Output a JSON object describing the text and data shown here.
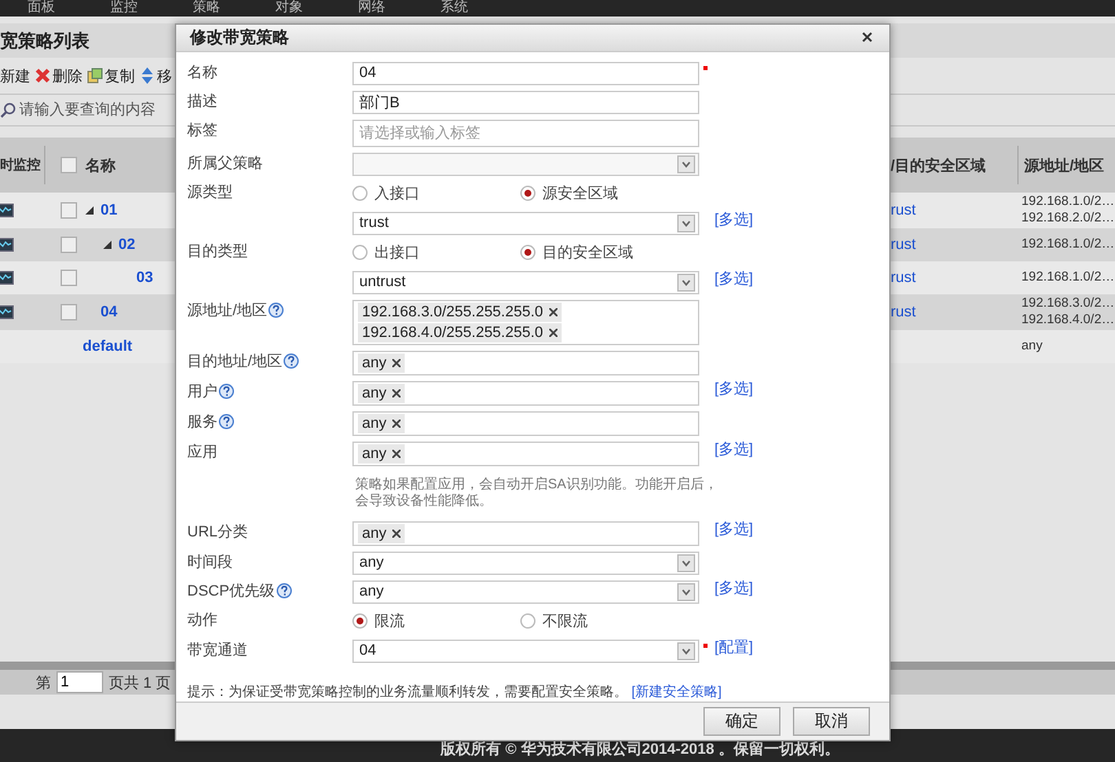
{
  "top_nav": [
    "面板",
    "监控",
    "策略",
    "对象",
    "网络",
    "系统"
  ],
  "policy_list": {
    "title": "宽策略列表",
    "toolbar": [
      {
        "kind": "new",
        "label": "新建"
      },
      {
        "kind": "delete",
        "label": "删除"
      },
      {
        "kind": "copy",
        "label": "复制"
      },
      {
        "kind": "move",
        "label": "移"
      }
    ],
    "search": {
      "placeholder": "请输入要查询的内容"
    },
    "columns": [
      "时监控",
      "名称",
      "/目的安全区域",
      "源地址/地区"
    ],
    "select_all": {
      "checked": false
    },
    "rows": [
      {
        "kind": "policy",
        "name": "01",
        "checked": false,
        "expanded": true,
        "zone": "rust",
        "sources": [
          "192.168.1.0/2…",
          "192.168.2.0/2…"
        ],
        "children": [
          {
            "kind": "policy",
            "name": "02",
            "checked": false,
            "expanded": true,
            "zone": "rust",
            "sources": [
              "192.168.1.0/2…"
            ],
            "children": [
              {
                "kind": "policy",
                "name": "03",
                "checked": false,
                "zone": "rust",
                "sources": [
                  "192.168.1.0/2…"
                ]
              }
            ]
          }
        ]
      },
      {
        "kind": "policy",
        "name": "04",
        "checked": false,
        "zone": "rust",
        "sources": [
          "192.168.3.0/2…",
          "192.168.4.0/2…"
        ]
      },
      {
        "kind": "default",
        "name": "default",
        "sources": [
          "any"
        ]
      }
    ],
    "pagination": {
      "prefix": "第",
      "page": "1",
      "suffix": "页共 1 页"
    }
  },
  "dialog": {
    "title": "修改带宽策略",
    "fields": [
      {
        "kind": "text",
        "label": "名称",
        "value": "04",
        "required": true
      },
      {
        "kind": "text",
        "label": "描述",
        "value": "部门B"
      },
      {
        "kind": "text",
        "label": "标签",
        "placeholder": "请选择或输入标签"
      },
      {
        "kind": "select",
        "label": "所属父策略",
        "disabled": true
      },
      {
        "kind": "radio",
        "label": "源类型",
        "options": [
          {
            "label": "入接口",
            "selected": false
          },
          {
            "label": "源安全区域",
            "selected": true
          }
        ]
      },
      {
        "kind": "select",
        "value": "trust",
        "link": "[多选]"
      },
      {
        "kind": "radio",
        "label": "目的类型",
        "options": [
          {
            "label": "出接口",
            "selected": false
          },
          {
            "label": "目的安全区域",
            "selected": true
          }
        ]
      },
      {
        "kind": "select",
        "value": "untrust",
        "link": "[多选]"
      },
      {
        "kind": "tags",
        "label": "源地址/地区",
        "help": true,
        "tags": [
          "192.168.3.0/255.255.255.0",
          "192.168.4.0/255.255.255.0"
        ]
      },
      {
        "kind": "tags",
        "label": "目的地址/地区",
        "help": true,
        "tags": [
          "any"
        ]
      },
      {
        "kind": "tags",
        "label": "用户",
        "help": true,
        "tags": [
          "any"
        ],
        "link": "[多选]"
      },
      {
        "kind": "tags",
        "label": "服务",
        "help": true,
        "tags": [
          "any"
        ]
      },
      {
        "kind": "tags",
        "label": "应用",
        "tags": [
          "any"
        ],
        "link": "[多选]"
      },
      {
        "kind": "note",
        "text": "策略如果配置应用，会自动开启SA识别功能。功能开启后，会导致设备性能降低。"
      },
      {
        "kind": "tags",
        "label": "URL分类",
        "tags": [
          "any"
        ],
        "link": "[多选]"
      },
      {
        "kind": "select",
        "label": "时间段",
        "value": "any"
      },
      {
        "kind": "select",
        "label": "DSCP优先级",
        "help": true,
        "value": "any",
        "link": "[多选]"
      },
      {
        "kind": "radio",
        "label": "动作",
        "options": [
          {
            "label": "限流",
            "selected": true
          },
          {
            "label": "不限流",
            "selected": false
          }
        ]
      },
      {
        "kind": "select",
        "label": "带宽通道",
        "value": "04",
        "required": true,
        "link": "[配置]"
      }
    ],
    "hint": {
      "text": "提示：为保证受带宽策略控制的业务流量顺利转发，需要配置安全策略。",
      "link": "[新建安全策略]"
    },
    "buttons": [
      "确定",
      "取消"
    ]
  },
  "footer": "版权所有 © 华为技术有限公司2014-2018 。保留一切权利。"
}
